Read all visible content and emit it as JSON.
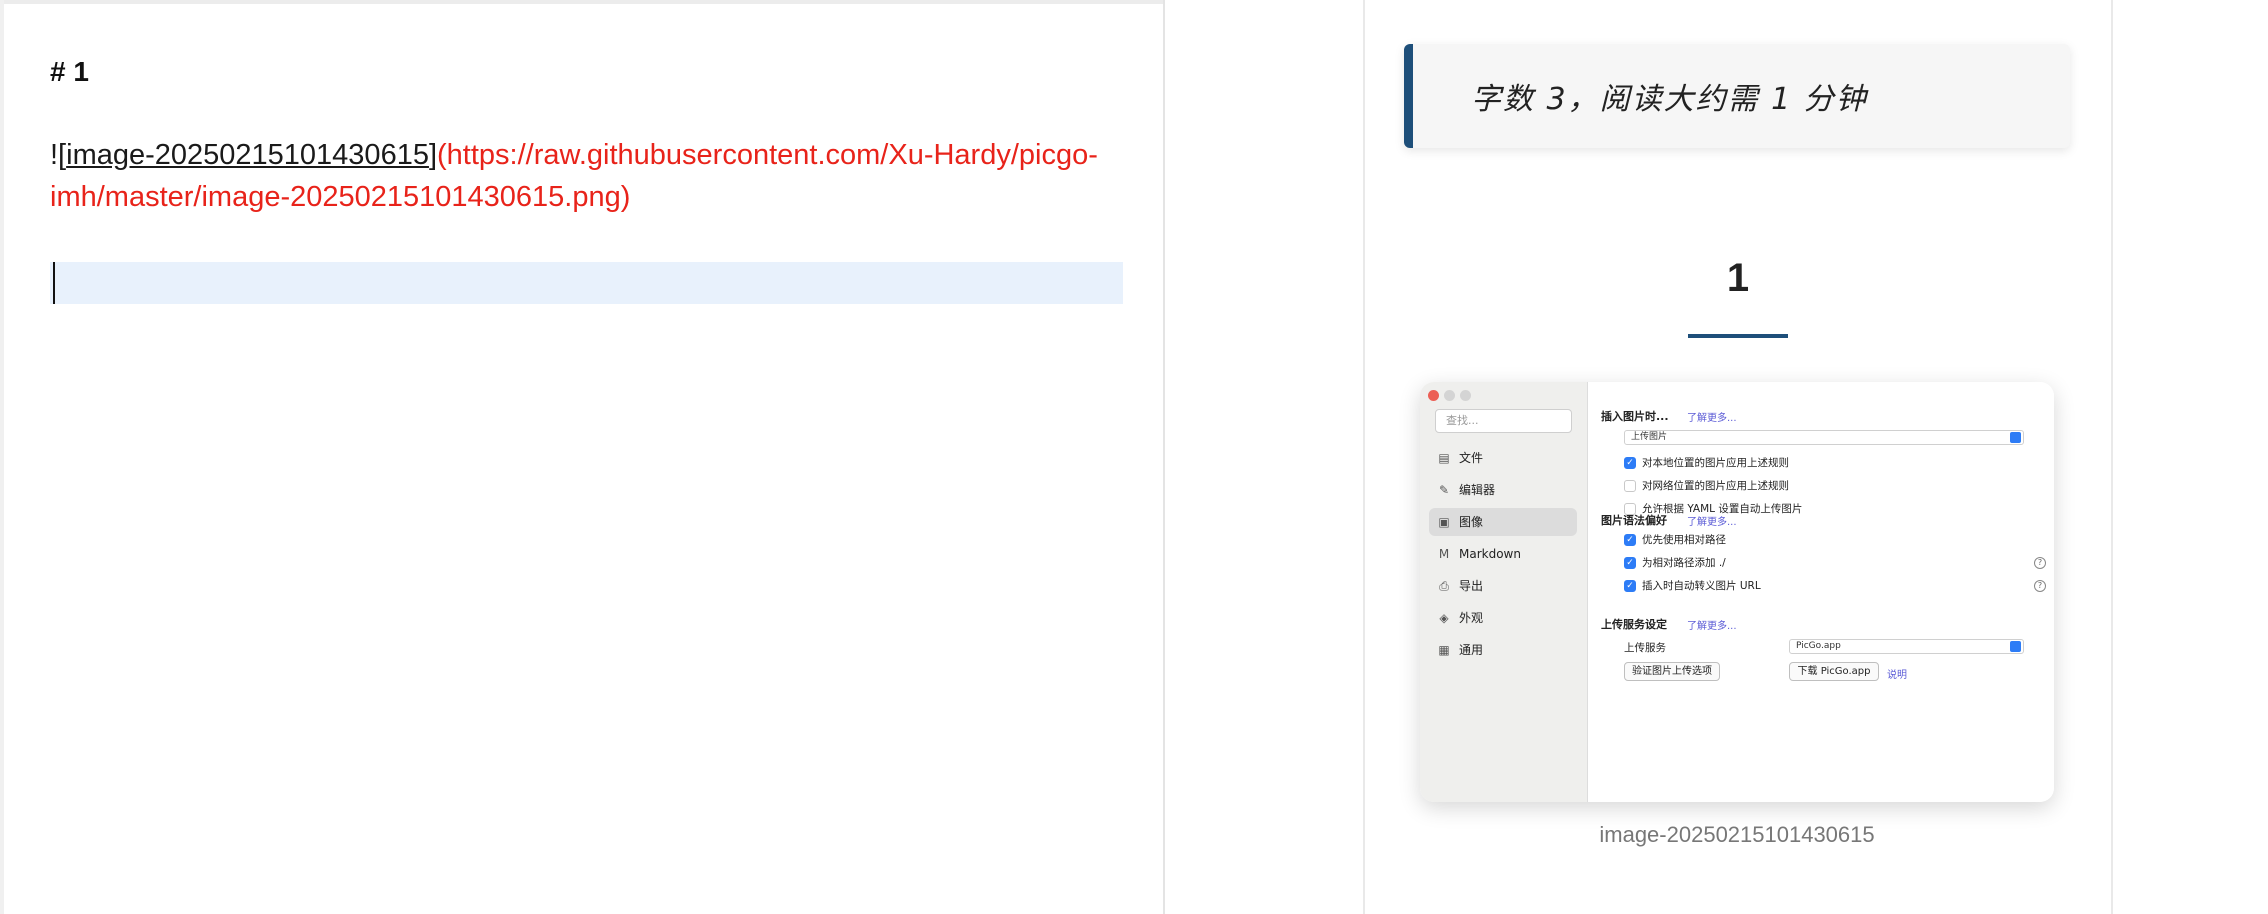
{
  "editor": {
    "heading": "# 1",
    "image_prefix": "![",
    "image_alt": "image-20250215101430615",
    "image_mid": "]",
    "image_url": "(https://raw.githubusercontent.com/Xu-Hardy/picgo-imh/master/image-20250215101430615.png)"
  },
  "preview": {
    "word_count_note": "字数 3，阅读大约需 1 分钟",
    "heading": "1",
    "caption": "image-20250215101430615"
  },
  "screenshot": {
    "search_placeholder": "查找...",
    "sidebar": [
      {
        "label": "文件",
        "icon": "file-icon",
        "glyph": "▤"
      },
      {
        "label": "编辑器",
        "icon": "pencil-icon",
        "glyph": "✎"
      },
      {
        "label": "图像",
        "icon": "image-icon",
        "glyph": "▣"
      },
      {
        "label": "Markdown",
        "icon": "markdown-icon",
        "glyph": "M"
      },
      {
        "label": "导出",
        "icon": "print-icon",
        "glyph": "⎙"
      },
      {
        "label": "外观",
        "icon": "paint-bucket-icon",
        "glyph": "◈"
      },
      {
        "label": "通用",
        "icon": "grid-icon",
        "glyph": "▦"
      }
    ],
    "section1": {
      "title": "插入图片时...",
      "link": "了解更多...",
      "select_value": "上传图片",
      "checks": [
        {
          "label": "对本地位置的图片应用上述规则",
          "checked": true
        },
        {
          "label": "对网络位置的图片应用上述规则",
          "checked": false
        },
        {
          "label": "允许根据 YAML 设置自动上传图片",
          "checked": false
        }
      ]
    },
    "section2": {
      "title": "图片语法偏好",
      "link": "了解更多...",
      "checks": [
        {
          "label": "优先使用相对路径",
          "checked": true
        },
        {
          "label": "为相对路径添加 ./",
          "checked": true
        },
        {
          "label": "插入时自动转义图片 URL",
          "checked": true
        }
      ]
    },
    "section3": {
      "title": "上传服务设定",
      "link": "了解更多...",
      "service_label": "上传服务",
      "service_value": "PicGo.app",
      "verify_button": "验证图片上传选项",
      "download_button": "下载 PicGo.app",
      "help_link": "说明"
    },
    "colors": {
      "accent": "#2d7cf6",
      "link": "#5b5bd6"
    }
  },
  "colors": {
    "url_red": "#e8231a",
    "accent_blue": "#1e4f7a",
    "active_line": "#e8f1fc"
  }
}
